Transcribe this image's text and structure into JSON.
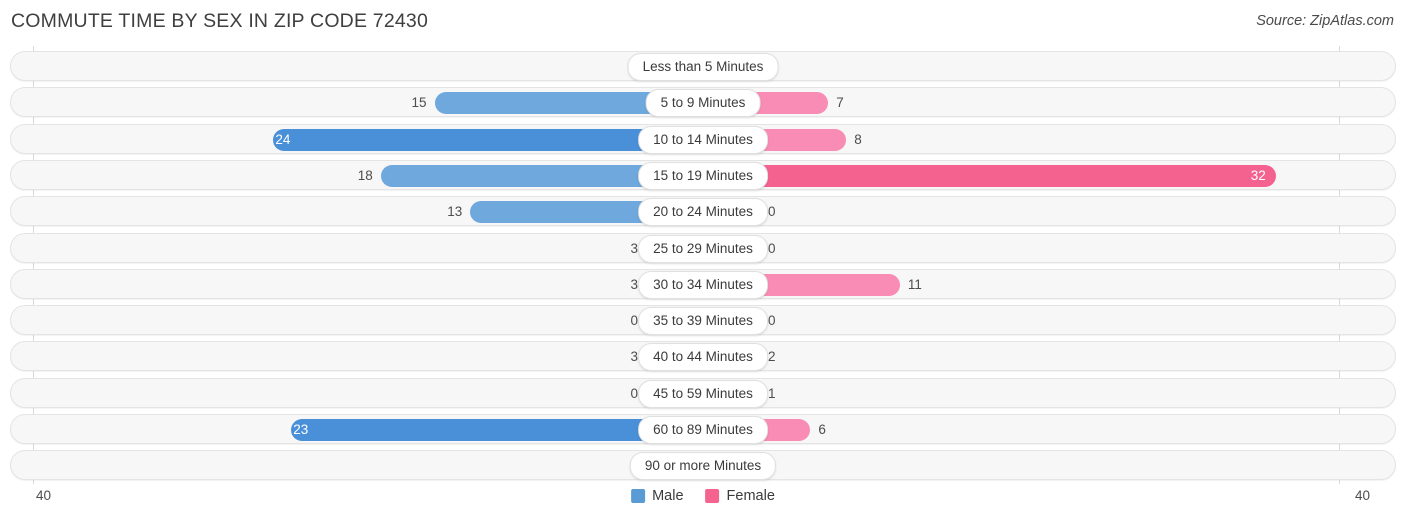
{
  "header": {
    "title": "COMMUTE TIME BY SEX IN ZIP CODE 72430",
    "source": "Source: ZipAtlas.com"
  },
  "legend": {
    "items": [
      {
        "label": "Male",
        "color": "#5b9bd5",
        "icon": "square-swatch"
      },
      {
        "label": "Female",
        "color": "#f4648f",
        "icon": "square-swatch"
      }
    ]
  },
  "axis": {
    "left_tick": "40",
    "right_tick": "40",
    "max": 40
  },
  "colors": {
    "male_strong": "#4a90d9",
    "male_mid": "#6ea8dd",
    "male_light": "#a9caec",
    "female_strong": "#f4628f",
    "female_mid": "#f98cb4",
    "female_light": "#f9afc8",
    "track": "#f7f7f7",
    "track_border": "#e4e4e4",
    "axis_line": "#d9d9d9"
  },
  "chart_data": {
    "type": "bar",
    "title": "COMMUTE TIME BY SEX IN ZIP CODE 72430",
    "subtitle": "",
    "xlabel": "",
    "ylabel": "",
    "orientation": "horizontal-diverging",
    "grid": false,
    "legend_position": "bottom-center",
    "xlim": [
      -40,
      40
    ],
    "axis_ticks": [
      "40",
      "40"
    ],
    "categories": [
      "Less than 5 Minutes",
      "5 to 9 Minutes",
      "10 to 14 Minutes",
      "15 to 19 Minutes",
      "20 to 24 Minutes",
      "25 to 29 Minutes",
      "30 to 34 Minutes",
      "35 to 39 Minutes",
      "40 to 44 Minutes",
      "45 to 59 Minutes",
      "60 to 89 Minutes",
      "90 or more Minutes"
    ],
    "series": [
      {
        "name": "Male",
        "values": [
          0,
          15,
          24,
          18,
          13,
          3,
          3,
          0,
          3,
          0,
          23,
          0
        ]
      },
      {
        "name": "Female",
        "values": [
          0,
          7,
          8,
          32,
          0,
          0,
          11,
          0,
          2,
          1,
          6,
          0
        ]
      }
    ]
  },
  "rows": [
    {
      "category": "Less than 5 Minutes",
      "male": "0",
      "female": "0"
    },
    {
      "category": "5 to 9 Minutes",
      "male": "15",
      "female": "7"
    },
    {
      "category": "10 to 14 Minutes",
      "male": "24",
      "female": "8"
    },
    {
      "category": "15 to 19 Minutes",
      "male": "18",
      "female": "32"
    },
    {
      "category": "20 to 24 Minutes",
      "male": "13",
      "female": "0"
    },
    {
      "category": "25 to 29 Minutes",
      "male": "3",
      "female": "0"
    },
    {
      "category": "30 to 34 Minutes",
      "male": "3",
      "female": "11"
    },
    {
      "category": "35 to 39 Minutes",
      "male": "0",
      "female": "0"
    },
    {
      "category": "40 to 44 Minutes",
      "male": "3",
      "female": "2"
    },
    {
      "category": "45 to 59 Minutes",
      "male": "0",
      "female": "1"
    },
    {
      "category": "60 to 89 Minutes",
      "male": "23",
      "female": "6"
    },
    {
      "category": "90 or more Minutes",
      "male": "0",
      "female": "0"
    }
  ]
}
